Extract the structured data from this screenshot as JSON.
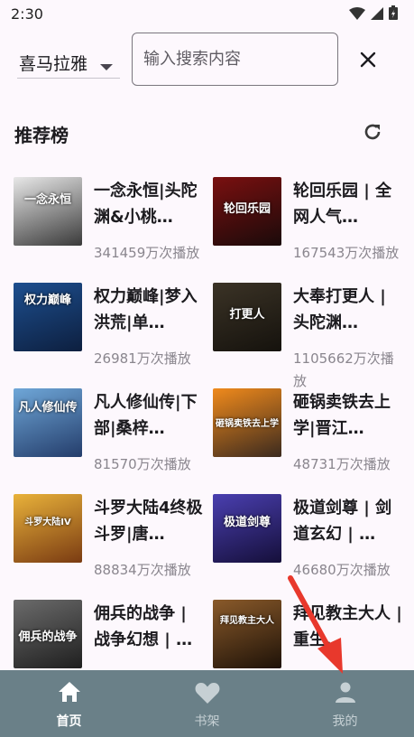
{
  "status_bar": {
    "time": "2:30"
  },
  "search": {
    "source_label": "喜马拉雅",
    "placeholder": "输入搜索内容",
    "value": ""
  },
  "section": {
    "title": "推荐榜"
  },
  "books": [
    {
      "title": "一念永恒|头陀渊&小桃…",
      "plays": "341459万次播放",
      "cover_text": "一念永恒",
      "cover_colors": [
        "#e8e8e8",
        "#3a3a3a"
      ]
    },
    {
      "title": "轮回乐园 | 全网人气…",
      "plays": "167543万次播放",
      "cover_text": "轮回乐园",
      "cover_colors": [
        "#7a1010",
        "#1a0a0a"
      ]
    },
    {
      "title": "权力巅峰|梦入洪荒|单…",
      "plays": "26981万次播放",
      "cover_text": "权力巅峰",
      "cover_colors": [
        "#1d4f8f",
        "#0d1f3f"
      ]
    },
    {
      "title": "大奉打更人 | 头陀渊…",
      "plays": "1105662万次播放",
      "cover_text": "打更人",
      "cover_colors": [
        "#3b3326",
        "#15120d"
      ]
    },
    {
      "title": "凡人修仙传|下部|桑梓…",
      "plays": "81570万次播放",
      "cover_text": "凡人修仙传",
      "cover_colors": [
        "#6fa7d8",
        "#243d6b"
      ]
    },
    {
      "title": "砸锅卖铁去上学|晋江…",
      "plays": "48731万次播放",
      "cover_text": "砸锅卖铁去上学",
      "cover_colors": [
        "#f08a1c",
        "#3b2a1e"
      ]
    },
    {
      "title": "斗罗大陆4终极斗罗|唐…",
      "plays": "88834万次播放",
      "cover_text": "斗罗大陆IV",
      "cover_colors": [
        "#e9b23a",
        "#7a3b12"
      ]
    },
    {
      "title": "极道剑尊 | 剑道玄幻 | …",
      "plays": "46680万次播放",
      "cover_text": "极道剑尊",
      "cover_colors": [
        "#4a3fb0",
        "#150f3a"
      ]
    },
    {
      "title": "佣兵的战争 | 战争幻想 | …",
      "plays": "",
      "cover_text": "佣兵的战争",
      "cover_colors": [
        "#6b6b6b",
        "#1f1f1f"
      ]
    },
    {
      "title": "拜见教主大人 | 重生…",
      "plays": "",
      "cover_text": "拜见教主大人",
      "cover_colors": [
        "#8a5a2a",
        "#1e1208"
      ]
    }
  ],
  "nav": {
    "items": [
      {
        "label": "首页",
        "icon": "home-icon",
        "active": true
      },
      {
        "label": "书架",
        "icon": "heart-icon",
        "active": false
      },
      {
        "label": "我的",
        "icon": "person-icon",
        "active": false
      }
    ]
  },
  "colors": {
    "background": "#fdf8fd",
    "nav_background": "#6a8088",
    "muted_text": "#8a868e",
    "annotation_arrow": "#e8382c"
  }
}
